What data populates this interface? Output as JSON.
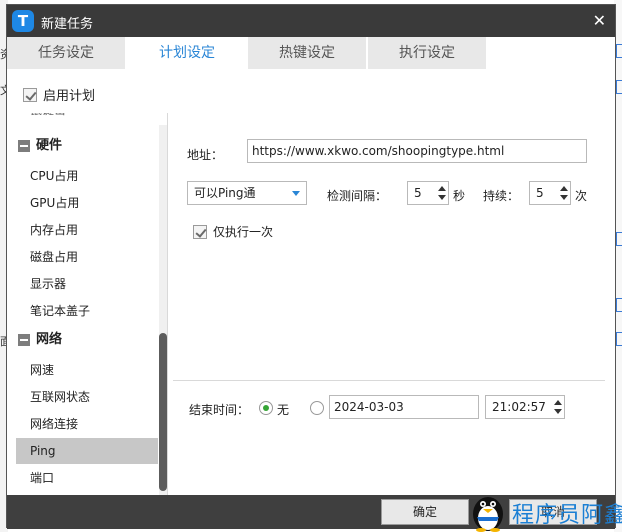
{
  "dialog": {
    "title": "新建任务",
    "close_glyph": "✕",
    "logo_letter": "T"
  },
  "tabs": [
    {
      "label": "任务设定",
      "active": false
    },
    {
      "label": "计划设定",
      "active": true
    },
    {
      "label": "热键设定",
      "active": false
    },
    {
      "label": "执行设定",
      "active": false
    }
  ],
  "enable_plan": {
    "label": "启用计划",
    "checked": true
  },
  "tree": {
    "cut_item": "鼠键击",
    "groups": [
      {
        "label": "硬件",
        "items": [
          "CPU占用",
          "GPU占用",
          "内存占用",
          "磁盘占用",
          "显示器",
          "笔记本盖子"
        ]
      },
      {
        "label": "网络",
        "items": [
          "网速",
          "互联网状态",
          "网络连接",
          "Ping",
          "端口"
        ]
      }
    ],
    "selected": "Ping"
  },
  "address": {
    "label": "地址：",
    "value": "https://www.xkwo.com/shoopingtype.html"
  },
  "ping_mode": {
    "value": "可以Ping通"
  },
  "interval": {
    "label": "检测间隔：",
    "value": "5",
    "unit": "秒"
  },
  "duration": {
    "label": "持续：",
    "value": "5",
    "unit": "次"
  },
  "run_once": {
    "label": "仅执行一次",
    "checked": true
  },
  "end_time": {
    "label": "结束时间：",
    "none_label": "无",
    "none_selected": true,
    "date": "2024-03-03",
    "time": "21:02:57"
  },
  "buttons": {
    "ok": "确定",
    "cancel": "取消"
  },
  "background": {
    "left_glyphs": [
      "资",
      "文",
      "面"
    ]
  },
  "watermark": {
    "text": "程序员阿鑫"
  }
}
